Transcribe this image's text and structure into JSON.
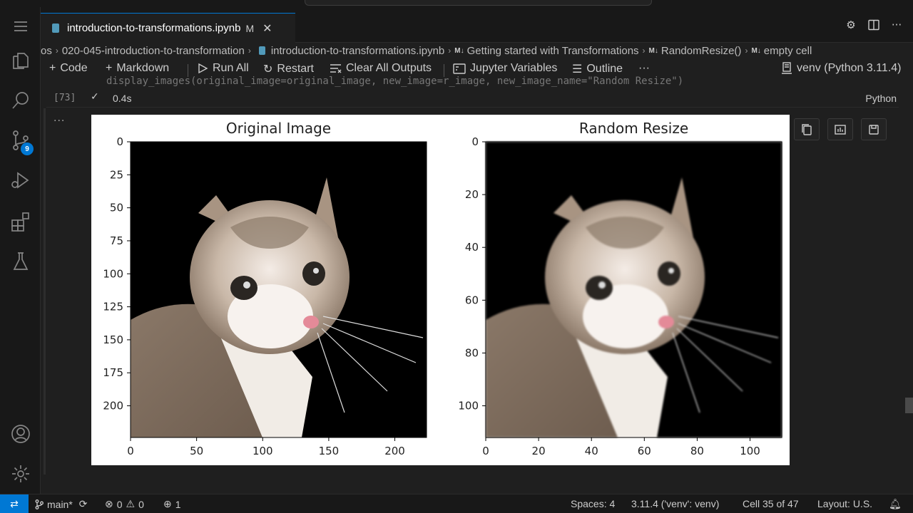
{
  "tab": {
    "title": "introduction-to-transformations.ipynb",
    "modified": "M",
    "close_icon": "close-icon"
  },
  "breadcrumb": {
    "items": [
      {
        "label": "os"
      },
      {
        "label": "020-045-introduction-to-transformation"
      },
      {
        "label": "introduction-to-transformations.ipynb"
      },
      {
        "label": "Getting started with Transformations",
        "prefix": "M↓"
      },
      {
        "label": "RandomResize()",
        "prefix": "M↓"
      },
      {
        "label": "empty cell",
        "prefix": "M↓"
      }
    ]
  },
  "toolbar": {
    "code": "Code",
    "markdown": "Markdown",
    "run_all": "Run All",
    "restart": "Restart",
    "clear_outputs": "Clear All Outputs",
    "variables": "Jupyter Variables",
    "outline": "Outline",
    "more": "···",
    "kernel": "venv (Python 3.11.4)"
  },
  "cell": {
    "code_peek": "display_images(original_image=original_image, new_image=r_image, new_image_name=\"Random Resize\")",
    "exec_count": "[73]",
    "check": "✓",
    "exec_time": "0.4s",
    "language": "Python",
    "output_more": "···"
  },
  "chart_data": [
    {
      "type": "image",
      "title": "Original Image",
      "xticks": [
        "0",
        "50",
        "100",
        "150",
        "200"
      ],
      "yticks": [
        "0",
        "25",
        "50",
        "75",
        "100",
        "125",
        "150",
        "175",
        "200"
      ],
      "xlim": [
        0,
        224
      ],
      "ylim": [
        224,
        0
      ]
    },
    {
      "type": "image",
      "title": "Random Resize",
      "xticks": [
        "0",
        "20",
        "40",
        "60",
        "80",
        "100"
      ],
      "yticks": [
        "0",
        "20",
        "40",
        "60",
        "80",
        "100"
      ],
      "xlim": [
        0,
        112
      ],
      "ylim": [
        112,
        0
      ]
    }
  ],
  "activity": {
    "scm_badge": "9"
  },
  "status": {
    "branch": "main*",
    "errors": "0",
    "warnings": "0",
    "ports": "1",
    "spaces": "Spaces: 4",
    "interpreter": "3.11.4 ('venv': venv)",
    "cell_pos": "Cell 35 of 47",
    "layout": "Layout: U.S."
  },
  "colors": {
    "accent": "#0078d4",
    "badge": "#0078d4"
  }
}
